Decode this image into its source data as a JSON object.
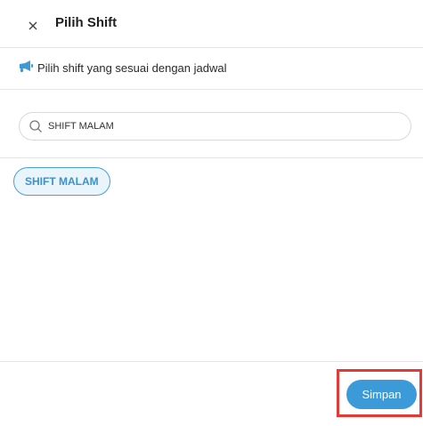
{
  "dialog": {
    "title": "Pilih Shift",
    "close_icon": "close-icon",
    "info": {
      "icon": "megaphone-icon",
      "text": "Pilih shift yang sesuai dengan jadwal"
    },
    "search": {
      "icon": "search-icon",
      "value": "SHIFT MALAM",
      "placeholder": ""
    },
    "results": [
      {
        "label": "SHIFT MALAM"
      }
    ],
    "footer": {
      "save_label": "Simpan"
    }
  },
  "colors": {
    "accent": "#3d9ad9",
    "chip_background": "#e9f4fb",
    "highlight": "#e53935"
  }
}
